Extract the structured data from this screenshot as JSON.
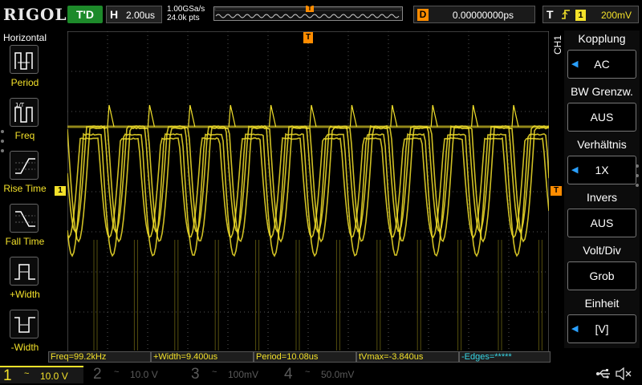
{
  "header": {
    "logo": "RIGOL",
    "trigger_status": "T'D",
    "timebase_key": "H",
    "timebase_value": "2.00us",
    "sample_rate": "1.00GSa/s",
    "memory_depth": "24.0k pts",
    "delay_key": "D",
    "delay_value": "0.00000000ps",
    "trigger_key": "T",
    "trigger_edge": "rising-edge-icon",
    "trigger_channel": "1",
    "trigger_level": "200mV"
  },
  "left_menu": {
    "title": "Horizontal",
    "items": [
      {
        "label": "Period",
        "icon": "period-icon"
      },
      {
        "label": "Freq",
        "icon": "frequency-icon"
      },
      {
        "label": "Rise Time",
        "icon": "rise-time-icon"
      },
      {
        "label": "Fall Time",
        "icon": "fall-time-icon"
      },
      {
        "label": "+Width",
        "icon": "positive-width-icon"
      },
      {
        "label": "-Width",
        "icon": "negative-width-icon"
      }
    ]
  },
  "screen": {
    "trigger_position_marker": "T",
    "ch1_offset_marker": "1",
    "trigger_level_marker": "T"
  },
  "right_menu": {
    "channel_label": "CH1",
    "items": [
      {
        "title": "Kopplung",
        "value": "AC",
        "has_arrow": true
      },
      {
        "title": "BW Grenzw.",
        "value": "AUS",
        "has_arrow": false
      },
      {
        "title": "Verhältnis",
        "value": "1X",
        "has_arrow": true
      },
      {
        "title": "Invers",
        "value": "AUS",
        "has_arrow": false
      },
      {
        "title": "Volt/Div",
        "value": "Grob",
        "has_arrow": false
      },
      {
        "title": "Einheit",
        "value": "[V]",
        "has_arrow": true
      }
    ]
  },
  "measurements": [
    "Freq=99.2kHz",
    "+Width=9.400us",
    "Period=10.08us",
    "tVmax=-3.840us",
    "-Edges=*****"
  ],
  "channels": [
    {
      "number": "1",
      "coupling": "~",
      "scale": "10.0 V",
      "active": true
    },
    {
      "number": "2",
      "coupling": "~",
      "scale": "10.0 V",
      "active": false
    },
    {
      "number": "3",
      "coupling": "~",
      "scale": "100mV",
      "active": false
    },
    {
      "number": "4",
      "coupling": "~",
      "scale": "50.0mV",
      "active": false
    }
  ],
  "status_icons": [
    "usb-icon",
    "speaker-muted-icon"
  ],
  "colors": {
    "ch1": "#f3e12a",
    "trigger": "#ff8c00",
    "triggered": "#1d8a2a",
    "measure_cyan": "#37d7e6"
  }
}
